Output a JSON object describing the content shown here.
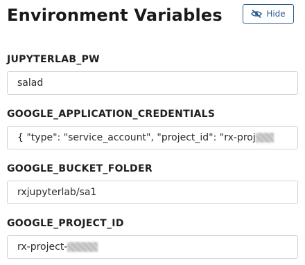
{
  "header": {
    "title": "Environment Variables",
    "hide_button_label": "Hide",
    "hide_icon": "eye-slash-icon"
  },
  "variables": [
    {
      "name": "JUPYTERLAB_PW",
      "value": "salad"
    },
    {
      "name": "GOOGLE_APPLICATION_CREDENTIALS",
      "value": "{ \"type\": \"service_account\", \"project_id\": \"rx-proj"
    },
    {
      "name": "GOOGLE_BUCKET_FOLDER",
      "value": "rxjupyterlab/sa1"
    },
    {
      "name": "GOOGLE_PROJECT_ID",
      "value": "rx-project-"
    }
  ],
  "colors": {
    "accent": "#2c5d8f",
    "field_border": "#cfd3d7",
    "text": "#1f1f1f"
  }
}
